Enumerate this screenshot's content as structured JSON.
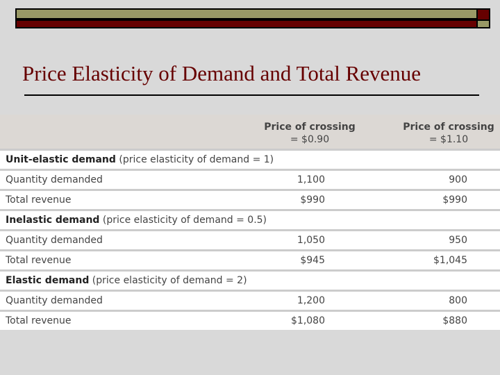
{
  "title": "Price Elasticity of Demand and Total Revenue",
  "columns": [
    {
      "line1": "Price of crossing",
      "line2": "= $0.90"
    },
    {
      "line1": "Price of crossing",
      "line2": "= $1.10"
    }
  ],
  "rows": [
    {
      "bold": "Unit-elastic demand",
      "rest": " (price elasticity of demand = 1)"
    },
    {
      "label": "Quantity demanded",
      "v1": "1,100",
      "v2": "900"
    },
    {
      "label": "Total revenue",
      "v1": "$990",
      "v2": "$990"
    },
    {
      "bold": "Inelastic demand",
      "rest": " (price elasticity of demand = 0.5)"
    },
    {
      "label": "Quantity demanded",
      "v1": "1,050",
      "v2": "950"
    },
    {
      "label": "Total revenue",
      "v1": "$945",
      "v2": "$1,045"
    },
    {
      "bold": "Elastic demand",
      "rest": " (price elasticity of demand = 2)"
    },
    {
      "label": "Quantity demanded",
      "v1": "1,200",
      "v2": "800"
    },
    {
      "label": "Total revenue",
      "v1": "$1,080",
      "v2": "$880"
    }
  ]
}
